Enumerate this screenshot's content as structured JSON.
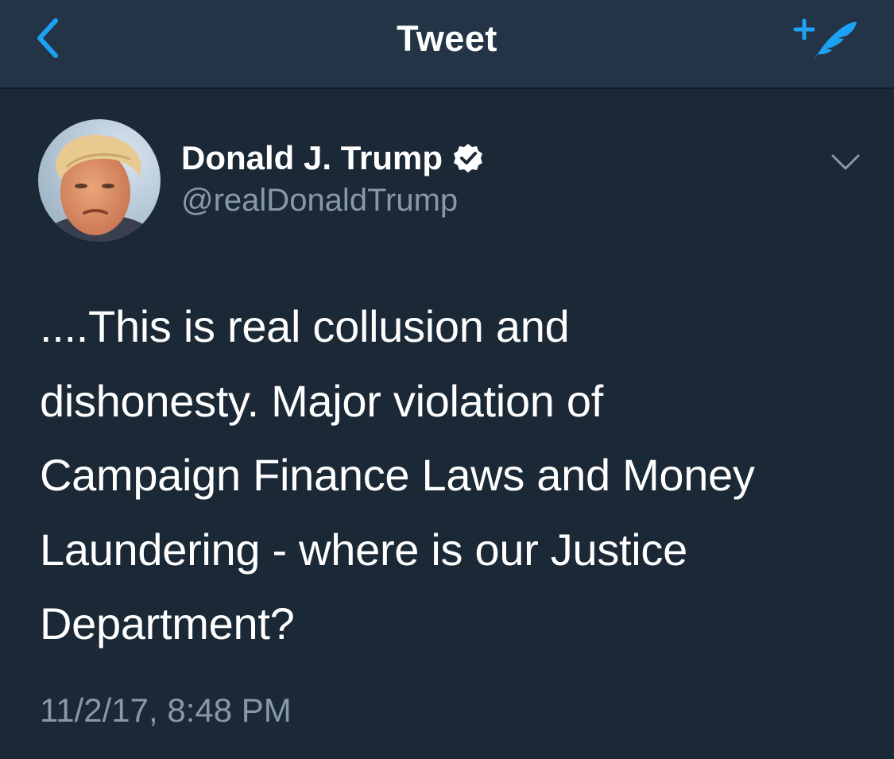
{
  "nav": {
    "title": "Tweet",
    "back_icon": "chevron-left-icon",
    "compose_icon": "compose-tweet-feather-icon"
  },
  "tweet": {
    "author": {
      "display_name": "Donald J. Trump",
      "handle": "@realDonaldTrump",
      "verified": true,
      "verified_icon": "verified-badge-icon"
    },
    "text": "....This is real collusion and\ndishonesty. Major violation of\nCampaign Finance Laws and Money\nLaundering - where is our Justice\nDepartment?",
    "timestamp": "11/2/17, 8:48 PM",
    "menu_icon": "chevron-down-icon"
  },
  "colors": {
    "background": "#1b2836",
    "nav_background": "#243447",
    "accent": "#1da1f2",
    "secondary_text": "#8899a6"
  }
}
